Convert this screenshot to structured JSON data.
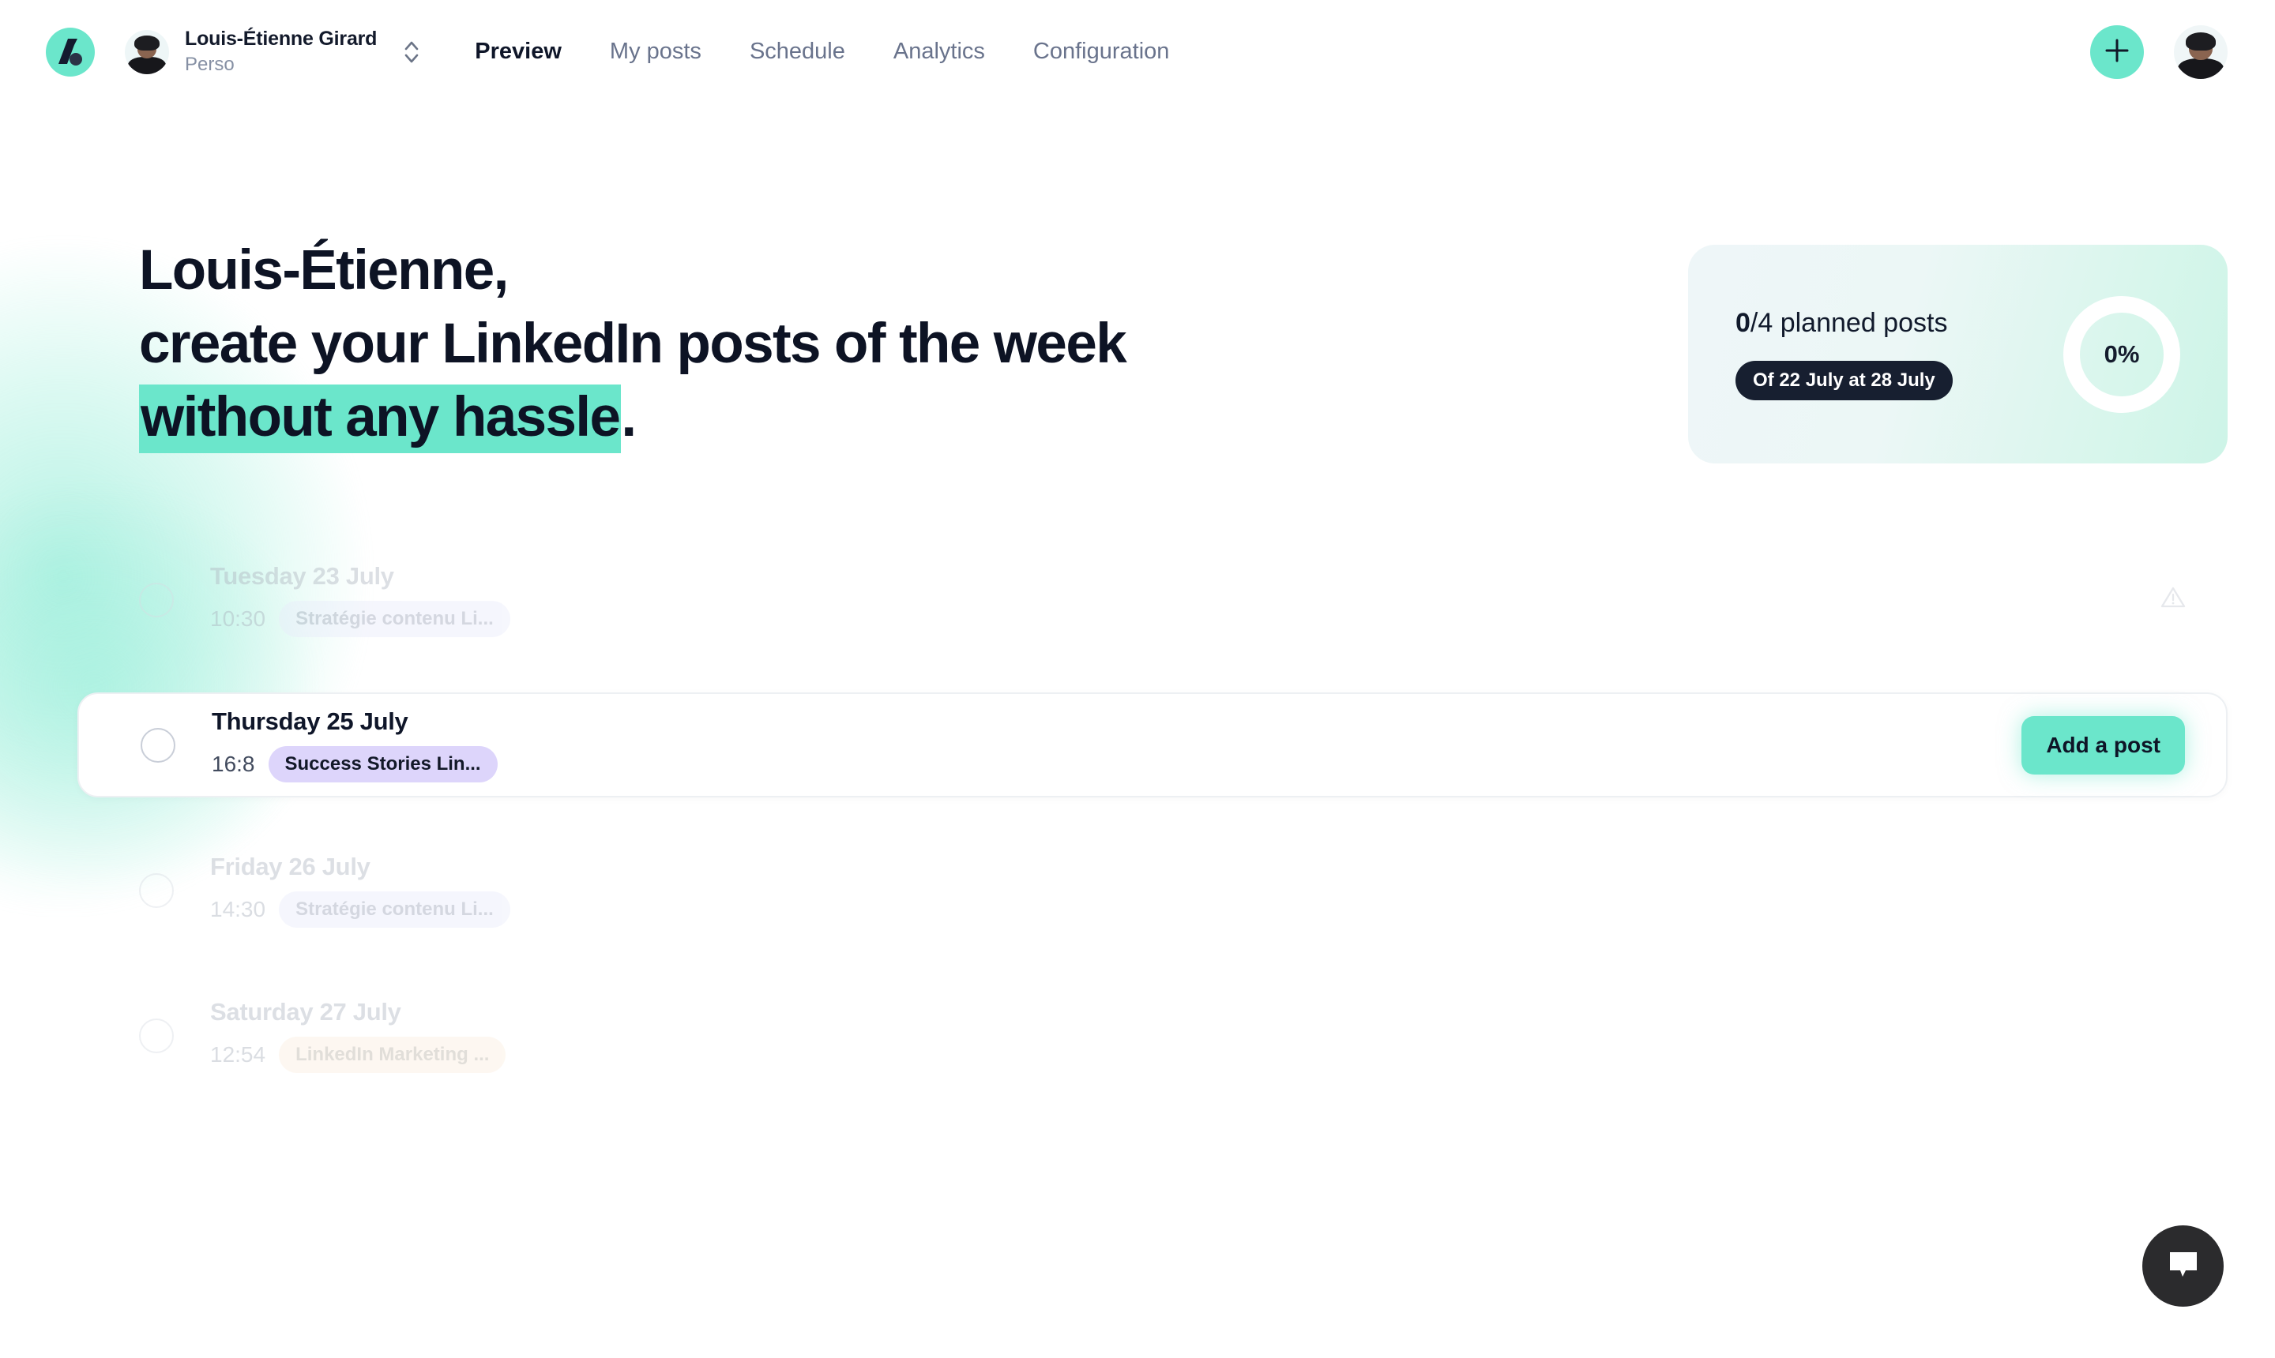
{
  "brand": {
    "logo_icon": "app-logo-icon",
    "accent_color": "#6BE6CB",
    "dark_color": "#131A2B"
  },
  "header": {
    "account": {
      "name": "Louis-Étienne Girard",
      "subtitle": "Perso",
      "avatar_icon": "account-avatar",
      "switch_icon": "chevron-up-down-icon"
    },
    "nav": [
      {
        "label": "Preview",
        "active": true
      },
      {
        "label": "My posts",
        "active": false
      },
      {
        "label": "Schedule",
        "active": false
      },
      {
        "label": "Analytics",
        "active": false
      },
      {
        "label": "Configuration",
        "active": false
      }
    ],
    "create_button_icon": "plus-icon",
    "user_avatar_icon": "user-avatar"
  },
  "hero": {
    "line1": "Louis-Étienne,",
    "line2": "create your LinkedIn posts of the week",
    "line3_highlight": "without any hassle",
    "line3_tail": "."
  },
  "progress": {
    "count_done": "0",
    "count_rest": "/4 planned posts",
    "range_label": "Of 22 July at 28 July",
    "percent": "0%"
  },
  "schedule": {
    "rows": [
      {
        "day": "Tuesday 23 July",
        "time": "10:30",
        "tag": "Stratégie contenu Li...",
        "tag_style": "blue",
        "state": "muted",
        "right_icon": "warning-triangle-icon"
      },
      {
        "day": "Thursday 25 July",
        "time": "16:8",
        "tag": "Success Stories Lin...",
        "tag_style": "purple",
        "state": "active",
        "action_label": "Add a post"
      },
      {
        "day": "Friday 26 July",
        "time": "14:30",
        "tag": "Stratégie contenu Li...",
        "tag_style": "blue",
        "state": "muted"
      },
      {
        "day": "Saturday 27 July",
        "time": "12:54",
        "tag": "LinkedIn Marketing ...",
        "tag_style": "peach",
        "state": "muted"
      }
    ]
  },
  "chat": {
    "icon": "chat-bubble-icon"
  }
}
